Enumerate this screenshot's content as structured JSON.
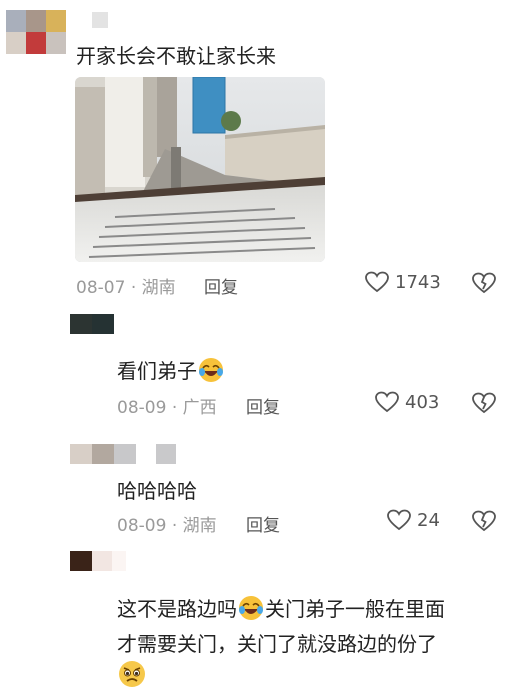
{
  "comments": [
    {
      "text": "开家长会不敢让家长来",
      "date": "08-07",
      "location": "湖南",
      "reply_label": "回复",
      "likes": "1743"
    },
    {
      "text": "看们弟子",
      "date": "08-09",
      "location": "广西",
      "reply_label": "回复",
      "likes": "403"
    },
    {
      "text": "哈哈哈哈",
      "date": "08-09",
      "location": "湖南",
      "reply_label": "回复",
      "likes": "24"
    },
    {
      "line1a": "这不是路边吗",
      "line1b": "关门弟子一般在里面",
      "line2": "才需要关门，关门了就没路边的份了"
    }
  ],
  "separator": "·",
  "icons": {
    "like": "heart-outline-icon",
    "dislike": "broken-heart-icon",
    "emoji_laugh_cry": "rolling-laughing-emoji",
    "emoji_worried": "worried-face-emoji"
  },
  "colors": {
    "meta": "#9a9a9a",
    "text": "#222222",
    "icon": "#555555"
  }
}
